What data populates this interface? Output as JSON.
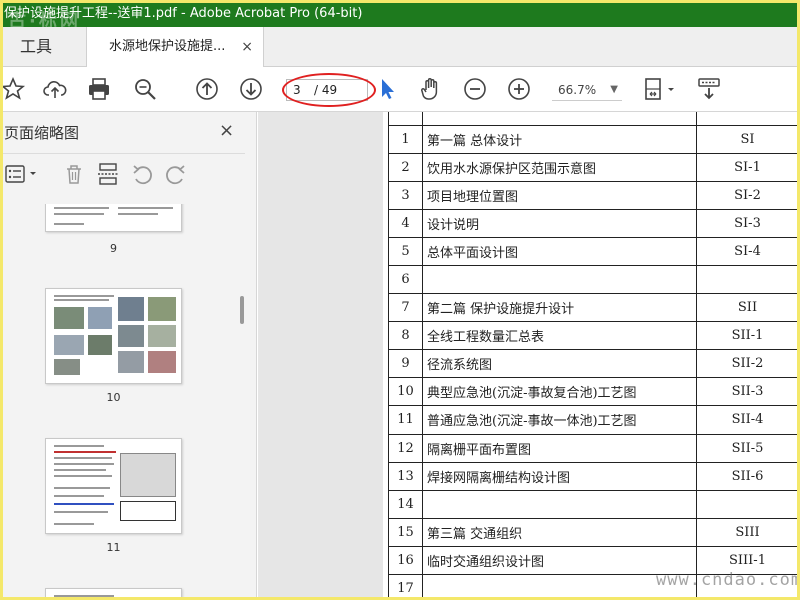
{
  "window": {
    "title": "保护设施提升工程--送审1.pdf - Adobe Acrobat Pro (64-bit)",
    "watermark_top": "古·标网"
  },
  "tabs": {
    "tools_label": "工具",
    "doc_tab_label": "水源地保护设施提...",
    "close_glyph": "×"
  },
  "toolbar": {
    "current_page": "3",
    "total_pages": "/ 49",
    "zoom": "66.7%",
    "icons": [
      "star-icon",
      "cloud-upload-icon",
      "print-icon",
      "zoom-search-icon",
      "page-up-icon",
      "page-down-icon",
      "select-cursor-icon",
      "hand-icon",
      "zoom-out-icon",
      "zoom-in-icon",
      "fit-page-icon",
      "keyboard-scroll-icon"
    ]
  },
  "sidebar": {
    "title": "页面缩略图",
    "close_glyph": "×",
    "thumbnails": [
      {
        "label": "9"
      },
      {
        "label": "10"
      },
      {
        "label": "11"
      }
    ]
  },
  "document": {
    "rows": [
      {
        "num": "1",
        "name": "第一篇  总体设计",
        "code": "SI"
      },
      {
        "num": "2",
        "name": "饮用水水源保护区范围示意图",
        "code": "SI-1"
      },
      {
        "num": "3",
        "name": "项目地理位置图",
        "code": "SI-2"
      },
      {
        "num": "4",
        "name": "设计说明",
        "code": "SI-3"
      },
      {
        "num": "5",
        "name": "总体平面设计图",
        "code": "SI-4"
      },
      {
        "num": "6",
        "name": "",
        "code": ""
      },
      {
        "num": "7",
        "name": "第二篇  保护设施提升设计",
        "code": "SII"
      },
      {
        "num": "8",
        "name": "全线工程数量汇总表",
        "code": "SII-1"
      },
      {
        "num": "9",
        "name": "径流系统图",
        "code": "SII-2"
      },
      {
        "num": "10",
        "name": "典型应急池(沉淀-事故复合池)工艺图",
        "code": "SII-3"
      },
      {
        "num": "11",
        "name": "普通应急池(沉淀-事故一体池)工艺图",
        "code": "SII-4"
      },
      {
        "num": "12",
        "name": "隔离栅平面布置图",
        "code": "SII-5"
      },
      {
        "num": "13",
        "name": "焊接网隔离栅结构设计图",
        "code": "SII-6"
      },
      {
        "num": "14",
        "name": "",
        "code": ""
      },
      {
        "num": "15",
        "name": "第三篇  交通组织",
        "code": "SIII"
      },
      {
        "num": "16",
        "name": "临时交通组织设计图",
        "code": "SIII-1"
      },
      {
        "num": "17",
        "name": "",
        "code": ""
      }
    ],
    "watermark_bottom": "www.cndao.com",
    "accent_red": "#e02020",
    "titlebar_green": "#1e7a1e"
  }
}
